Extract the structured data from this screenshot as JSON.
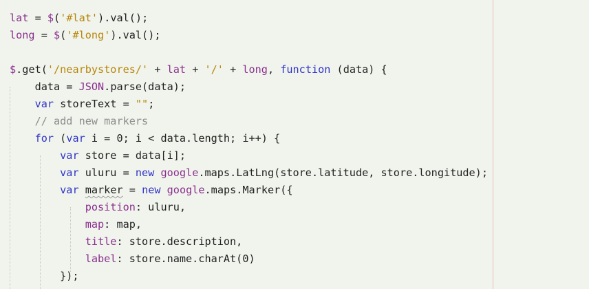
{
  "editor": {
    "lines": [
      {
        "tokens": [
          {
            "text": "lat",
            "kind": "variable"
          },
          {
            "text": " = ",
            "kind": "default"
          },
          {
            "text": "$",
            "kind": "variable"
          },
          {
            "text": "(",
            "kind": "punct"
          },
          {
            "text": "'#lat'",
            "kind": "string"
          },
          {
            "text": ").val();",
            "kind": "default"
          }
        ]
      },
      {
        "tokens": [
          {
            "text": "long",
            "kind": "variable"
          },
          {
            "text": " = ",
            "kind": "default"
          },
          {
            "text": "$",
            "kind": "variable"
          },
          {
            "text": "(",
            "kind": "punct"
          },
          {
            "text": "'#long'",
            "kind": "string"
          },
          {
            "text": ").val();",
            "kind": "default"
          }
        ]
      },
      {
        "tokens": []
      },
      {
        "tokens": [
          {
            "text": "$",
            "kind": "variable"
          },
          {
            "text": ".get(",
            "kind": "default"
          },
          {
            "text": "'/nearbystores/'",
            "kind": "string"
          },
          {
            "text": " + ",
            "kind": "default"
          },
          {
            "text": "lat",
            "kind": "variable"
          },
          {
            "text": " + ",
            "kind": "default"
          },
          {
            "text": "'/'",
            "kind": "string"
          },
          {
            "text": " + ",
            "kind": "default"
          },
          {
            "text": "long",
            "kind": "variable"
          },
          {
            "text": ", ",
            "kind": "default"
          },
          {
            "text": "function",
            "kind": "keyword"
          },
          {
            "text": " (data) {",
            "kind": "default"
          }
        ]
      },
      {
        "tokens": [
          {
            "text": "    data = ",
            "kind": "default"
          },
          {
            "text": "JSON",
            "kind": "variable"
          },
          {
            "text": ".parse(data);",
            "kind": "default"
          }
        ]
      },
      {
        "tokens": [
          {
            "text": "    ",
            "kind": "default"
          },
          {
            "text": "var",
            "kind": "keyword"
          },
          {
            "text": " storeText = ",
            "kind": "default"
          },
          {
            "text": "\"\"",
            "kind": "string"
          },
          {
            "text": ";",
            "kind": "default"
          }
        ]
      },
      {
        "tokens": [
          {
            "text": "    ",
            "kind": "default"
          },
          {
            "text": "// add new markers",
            "kind": "comment"
          }
        ]
      },
      {
        "tokens": [
          {
            "text": "    ",
            "kind": "default"
          },
          {
            "text": "for",
            "kind": "keyword"
          },
          {
            "text": " (",
            "kind": "default"
          },
          {
            "text": "var",
            "kind": "keyword"
          },
          {
            "text": " i = 0; i < data.length; i++) {",
            "kind": "default"
          }
        ]
      },
      {
        "tokens": [
          {
            "text": "        ",
            "kind": "default"
          },
          {
            "text": "var",
            "kind": "keyword"
          },
          {
            "text": " store = data[i];",
            "kind": "default"
          }
        ]
      },
      {
        "tokens": [
          {
            "text": "        ",
            "kind": "default"
          },
          {
            "text": "var",
            "kind": "keyword"
          },
          {
            "text": " uluru = ",
            "kind": "default"
          },
          {
            "text": "new",
            "kind": "keyword"
          },
          {
            "text": " ",
            "kind": "default"
          },
          {
            "text": "google",
            "kind": "variable"
          },
          {
            "text": ".maps.LatLng(store.latitude, store.longitude);",
            "kind": "default"
          }
        ]
      },
      {
        "tokens": [
          {
            "text": "        ",
            "kind": "default"
          },
          {
            "text": "var",
            "kind": "keyword"
          },
          {
            "text": " ",
            "kind": "default"
          },
          {
            "text": "marker",
            "kind": "default",
            "squiggle": true
          },
          {
            "text": " = ",
            "kind": "default"
          },
          {
            "text": "new",
            "kind": "keyword"
          },
          {
            "text": " ",
            "kind": "default"
          },
          {
            "text": "google",
            "kind": "variable"
          },
          {
            "text": ".maps.Marker({",
            "kind": "default"
          }
        ]
      },
      {
        "tokens": [
          {
            "text": "            ",
            "kind": "default"
          },
          {
            "text": "position",
            "kind": "variable"
          },
          {
            "text": ": uluru,",
            "kind": "default"
          }
        ]
      },
      {
        "tokens": [
          {
            "text": "            ",
            "kind": "default"
          },
          {
            "text": "map",
            "kind": "variable"
          },
          {
            "text": ": map,",
            "kind": "default"
          }
        ]
      },
      {
        "tokens": [
          {
            "text": "            ",
            "kind": "default"
          },
          {
            "text": "title",
            "kind": "variable"
          },
          {
            "text": ": store.description,",
            "kind": "default"
          }
        ]
      },
      {
        "tokens": [
          {
            "text": "            ",
            "kind": "default"
          },
          {
            "text": "label",
            "kind": "variable"
          },
          {
            "text": ": store.name.charAt(0)",
            "kind": "default"
          }
        ]
      },
      {
        "tokens": [
          {
            "text": "        });",
            "kind": "default"
          }
        ]
      }
    ]
  },
  "colors": {
    "background": "#f0f4ec",
    "text": "#222222",
    "variable": "#8b2f8f",
    "string": "#b8860b",
    "keyword": "#2f33c7",
    "comment": "#8d8d8d",
    "print_margin": "#f3b9b9"
  }
}
